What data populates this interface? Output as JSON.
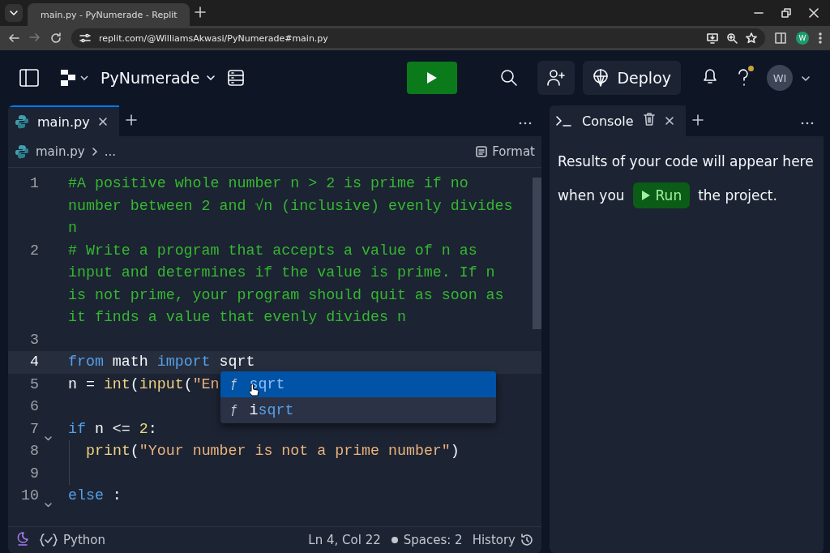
{
  "browser": {
    "tabs": [
      {
        "title": "main.py - PyNumerade - Replit",
        "selected": true
      }
    ],
    "url": "replit.com/@WilliamsAkwasi/PyNumerade#main.py",
    "profile": "W"
  },
  "header": {
    "project": "PyNumerade",
    "deploy": "Deploy",
    "avatar": "WI",
    "notification_dot": true
  },
  "editor": {
    "tabs": [
      {
        "label": "main.py",
        "selected": true
      }
    ],
    "breadcrumb": [
      "main.py",
      "..."
    ],
    "format": "Format",
    "lines": [
      {
        "number": "1",
        "fold": false,
        "current": false,
        "indented": false,
        "rows": [
          [
            {
              "kind": "comment",
              "text": "#A positive whole number n > 2 is prime if no"
            }
          ],
          [
            {
              "kind": "comment",
              "text": "number between 2 and √n (inclusive) evenly divides"
            }
          ],
          [
            {
              "kind": "comment",
              "text": "n"
            }
          ]
        ]
      },
      {
        "number": "2",
        "fold": false,
        "current": false,
        "indented": false,
        "rows": [
          [
            {
              "kind": "comment",
              "text": "# Write a program that accepts a value of n as"
            }
          ],
          [
            {
              "kind": "comment",
              "text": "input and determines if the value is prime. If n"
            }
          ],
          [
            {
              "kind": "comment",
              "text": "is not prime, your program should quit as soon as"
            }
          ],
          [
            {
              "kind": "comment",
              "text": "it finds a value that evenly divides n"
            }
          ]
        ]
      },
      {
        "number": "3",
        "fold": false,
        "current": false,
        "indented": false
      },
      {
        "number": "4",
        "fold": false,
        "current": true,
        "indented": false,
        "rows": [
          [
            {
              "kind": "keyword",
              "text": "from"
            },
            {
              "kind": "name",
              "text": " math "
            },
            {
              "kind": "keyword",
              "text": "import"
            },
            {
              "kind": "name",
              "text": " sqrt"
            }
          ]
        ]
      },
      {
        "number": "5",
        "fold": false,
        "current": false,
        "indented": false,
        "rows": [
          [
            {
              "kind": "name",
              "text": "n = "
            },
            {
              "kind": "func",
              "text": "int"
            },
            {
              "kind": "name",
              "text": "("
            },
            {
              "kind": "func",
              "text": "input"
            },
            {
              "kind": "name",
              "text": "("
            },
            {
              "kind": "string",
              "text": "\"En"
            }
          ]
        ]
      },
      {
        "number": "6",
        "fold": false,
        "current": false,
        "indented": false
      },
      {
        "number": "7",
        "fold": true,
        "current": false,
        "indented": false,
        "rows": [
          [
            {
              "kind": "keyword",
              "text": "if"
            },
            {
              "kind": "name",
              "text": " n <= "
            },
            {
              "kind": "number",
              "text": "2"
            },
            {
              "kind": "name",
              "text": ":"
            }
          ]
        ]
      },
      {
        "number": "8",
        "fold": false,
        "current": false,
        "indented": true,
        "rows": [
          [
            {
              "kind": "func",
              "text": "print"
            },
            {
              "kind": "name",
              "text": "("
            },
            {
              "kind": "string",
              "text": "\"Your number is not a prime number\""
            },
            {
              "kind": "name",
              "text": ")"
            }
          ]
        ]
      },
      {
        "number": "9",
        "fold": false,
        "current": false,
        "indented": true
      },
      {
        "number": "10",
        "fold": true,
        "current": false,
        "indented": false,
        "rows": [
          [
            {
              "kind": "keyword",
              "text": "else"
            },
            {
              "kind": "name",
              "text": " :"
            }
          ]
        ]
      }
    ],
    "suggestions": [
      {
        "icon": "ƒ",
        "match": "sqrt",
        "selected": true
      },
      {
        "icon": "ƒ",
        "prefix": "i",
        "match": "sqrt",
        "selected": false
      }
    ],
    "status": {
      "language": "Python",
      "position": "Ln 4, Col 22",
      "spaces": "Spaces: 2",
      "history": "History"
    }
  },
  "console": {
    "tabs": [
      {
        "label": "Console",
        "selected": true
      }
    ],
    "message_start": "Results of your code will appear here",
    "message_when": "when you",
    "run": "Run",
    "message_end": "the project."
  }
}
